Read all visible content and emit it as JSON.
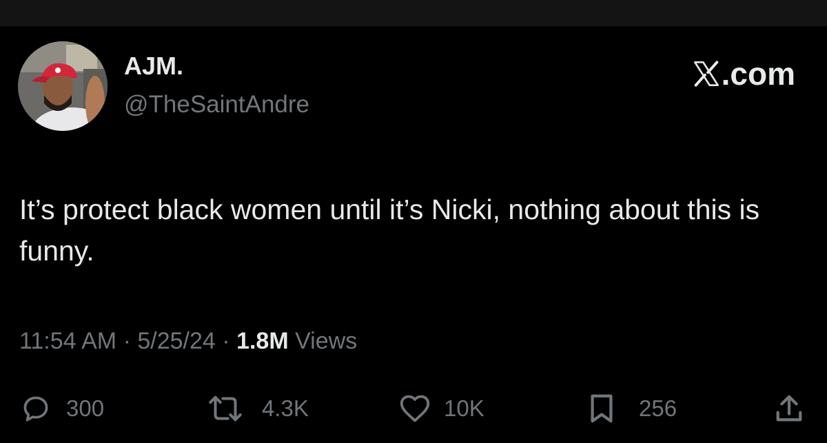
{
  "author": {
    "display_name": "AJM.",
    "handle": "@TheSaintAndre"
  },
  "brand": {
    "label": ".com",
    "icon": "x-logo-icon"
  },
  "tweet": {
    "text": "It’s protect black women until it’s Nicki, nothing about this is funny."
  },
  "meta": {
    "time": "11:54 AM",
    "separator": "·",
    "date": "5/25/24",
    "views_count": "1.8M",
    "views_label": "Views"
  },
  "actions": {
    "replies": "300",
    "reposts": "4.3K",
    "likes": "10K",
    "bookmarks": "256"
  },
  "colors": {
    "background": "#000000",
    "primary_text": "#e7e9ea",
    "secondary_text": "#71767b"
  }
}
